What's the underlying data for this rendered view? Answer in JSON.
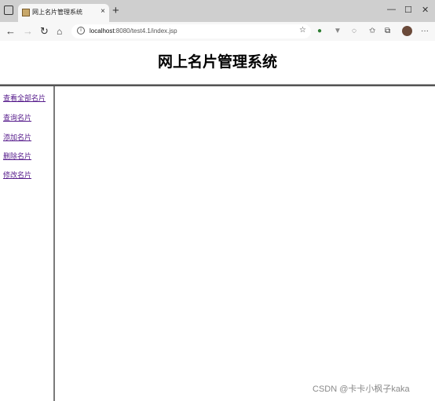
{
  "browser": {
    "tab_title": "网上名片管理系统",
    "tab_close": "×",
    "new_tab": "+",
    "url_host": "localhost",
    "url_rest": ":8080/test4.1/index.jsp",
    "window_controls": [
      "—",
      "☐",
      "✕"
    ]
  },
  "page": {
    "title": "网上名片管理系统"
  },
  "nav": {
    "items": [
      {
        "label": "查看全部名片"
      },
      {
        "label": "查询名片"
      },
      {
        "label": "添加名片"
      },
      {
        "label": "删除名片"
      },
      {
        "label": "修改名片"
      }
    ]
  },
  "watermark": "CSDN @卡卡小枫子kaka"
}
